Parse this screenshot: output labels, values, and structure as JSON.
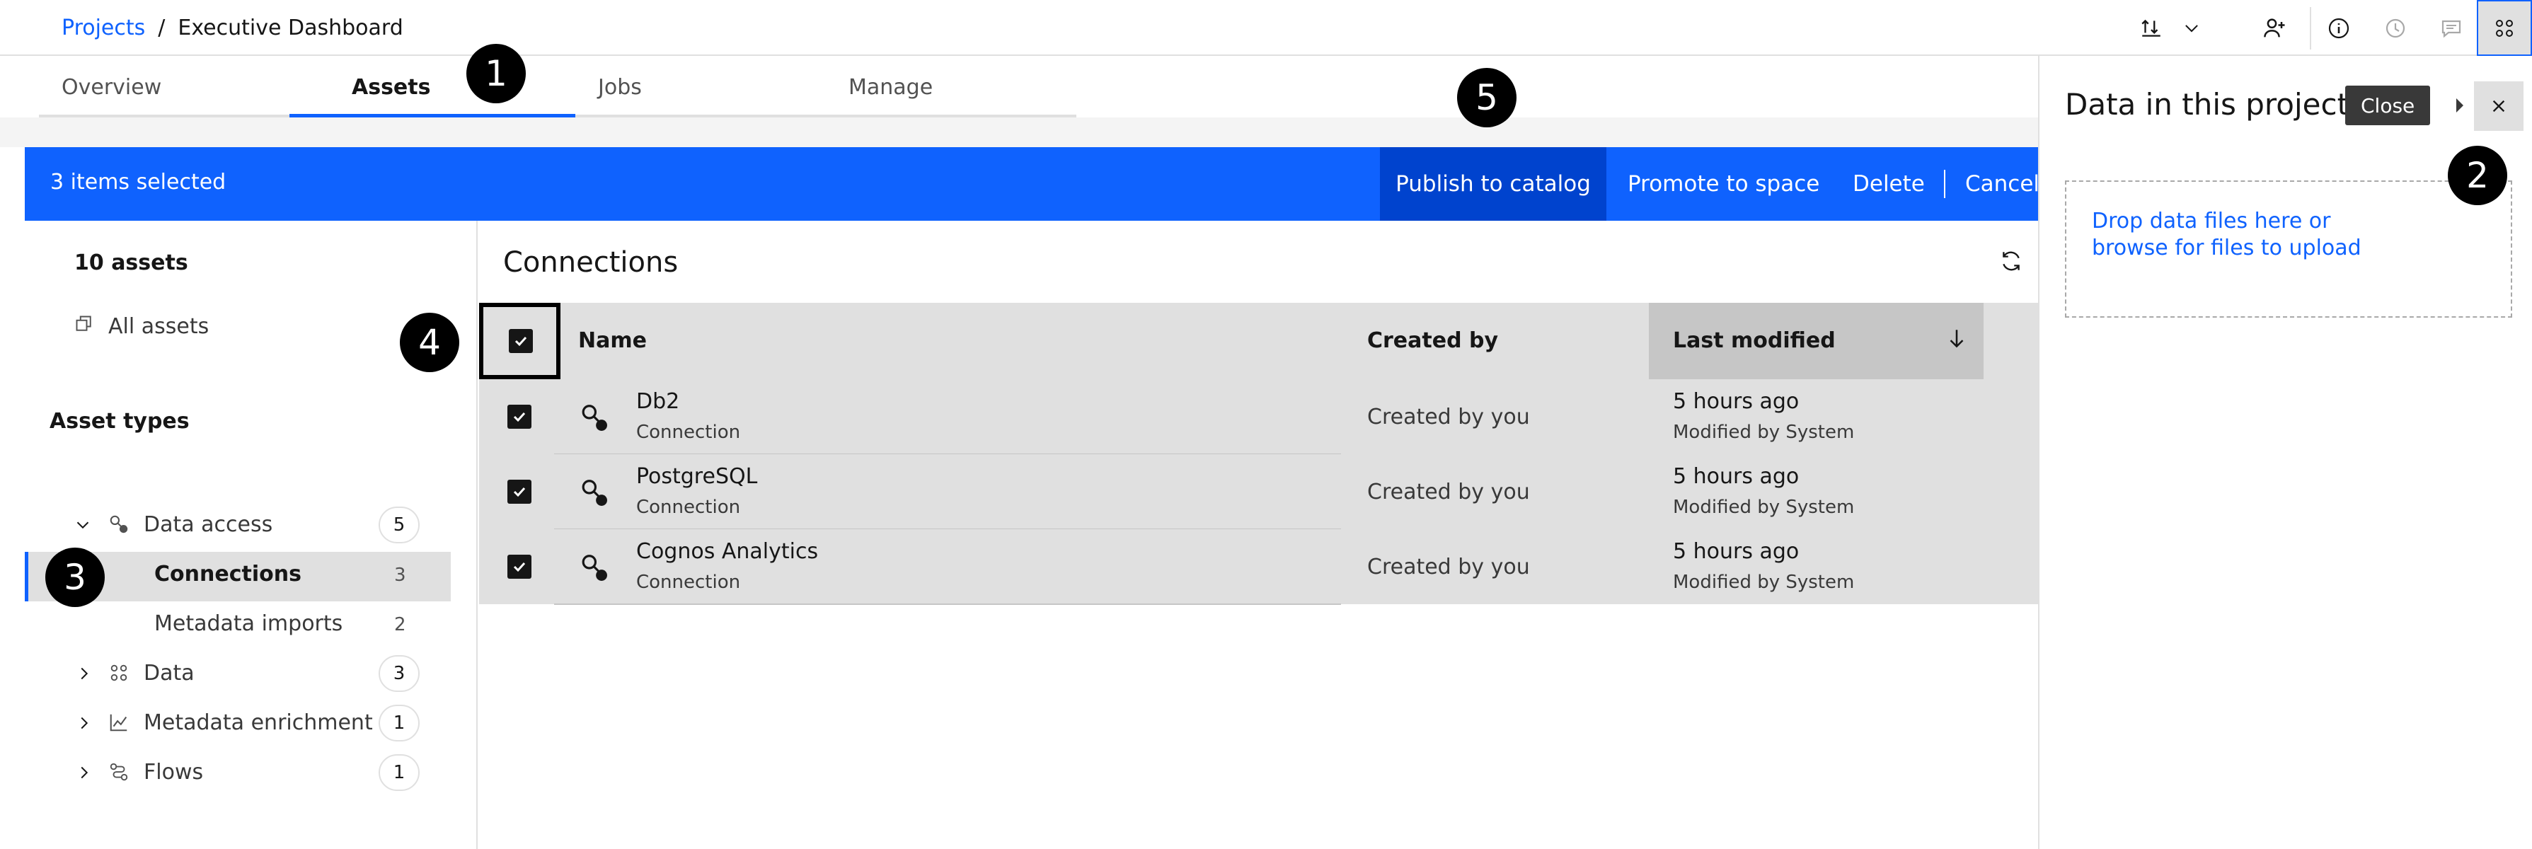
{
  "header": {
    "breadcrumb_root": "Projects",
    "breadcrumb_sep": "/",
    "breadcrumb_current": "Executive Dashboard",
    "icons": [
      "import-export-icon",
      "chevron-down-icon",
      "add-collaborator-icon",
      "information-icon",
      "history-icon",
      "chat-icon",
      "data-assets-icon"
    ]
  },
  "tabs": [
    {
      "label": "Overview"
    },
    {
      "label": "Assets"
    },
    {
      "label": "Jobs"
    },
    {
      "label": "Manage"
    }
  ],
  "selection_bar": {
    "count_label": "3 items selected",
    "publish": "Publish to catalog",
    "promote": "Promote to space",
    "delete": "Delete",
    "cancel": "Cancel"
  },
  "left_panel": {
    "assets_count": "10 assets",
    "all_assets": "All assets",
    "asset_types_heading": "Asset types",
    "groups": [
      {
        "label": "Data access",
        "count": "5",
        "expanded": true,
        "children": [
          {
            "label": "Connections",
            "count": "3",
            "selected": true
          },
          {
            "label": "Metadata imports",
            "count": "2"
          }
        ]
      },
      {
        "label": "Data",
        "count": "3"
      },
      {
        "label": "Metadata enrichment",
        "count": "1"
      },
      {
        "label": "Flows",
        "count": "1"
      }
    ]
  },
  "main": {
    "section_title": "Connections",
    "columns": {
      "name": "Name",
      "created_by": "Created by",
      "last_modified": "Last modified"
    },
    "rows": [
      {
        "name": "Db2",
        "type": "Connection",
        "created_by": "Created by you",
        "modified": "5 hours ago",
        "modified_by": "Modified by System"
      },
      {
        "name": "PostgreSQL",
        "type": "Connection",
        "created_by": "Created by you",
        "modified": "5 hours ago",
        "modified_by": "Modified by System"
      },
      {
        "name": "Cognos Analytics",
        "type": "Connection",
        "created_by": "Created by you",
        "modified": "5 hours ago",
        "modified_by": "Modified by System"
      }
    ]
  },
  "right_panel": {
    "title": "Data in this project",
    "tooltip": "Close",
    "drop_line1": "Drop data files here or",
    "drop_line2": "browse for files to upload"
  },
  "callouts": [
    "1",
    "2",
    "3",
    "4",
    "5"
  ],
  "colors": {
    "accent": "#0f62fe",
    "accent_dark": "#0043ce",
    "row_bg": "#e0e0e0",
    "sort_col_bg": "#c6c6c6"
  }
}
